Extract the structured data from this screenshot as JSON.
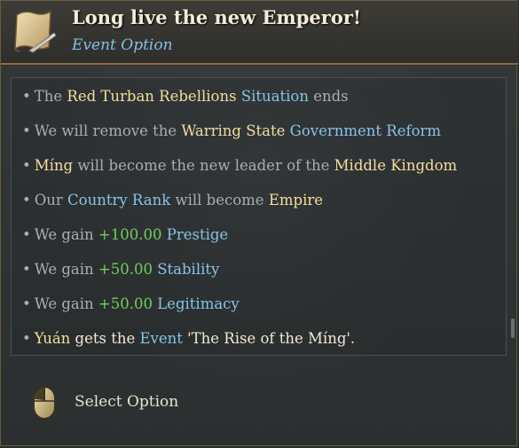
{
  "header": {
    "title": "Long live the new Emperor!",
    "subtitle": "Event Option",
    "icon": "scroll-quill-icon"
  },
  "effects": [
    [
      {
        "t": "The ",
        "c": "plain"
      },
      {
        "t": "Red Turban Rebellions",
        "c": "hl"
      },
      {
        "t": " ",
        "c": "plain"
      },
      {
        "t": "Situation",
        "c": "kw"
      },
      {
        "t": " ends",
        "c": "plain"
      }
    ],
    [
      {
        "t": "We will remove the ",
        "c": "plain"
      },
      {
        "t": "Warring State",
        "c": "hl"
      },
      {
        "t": " ",
        "c": "plain"
      },
      {
        "t": "Government Reform",
        "c": "kw"
      }
    ],
    [
      {
        "t": "Míng",
        "c": "hl"
      },
      {
        "t": " will become the new leader of the ",
        "c": "plain"
      },
      {
        "t": "Middle Kingdom",
        "c": "hl"
      }
    ],
    [
      {
        "t": "Our ",
        "c": "plain"
      },
      {
        "t": "Country Rank",
        "c": "kw"
      },
      {
        "t": " will become ",
        "c": "plain"
      },
      {
        "t": "Empire",
        "c": "hl"
      }
    ],
    [
      {
        "t": "We gain ",
        "c": "plain"
      },
      {
        "t": "+100.00",
        "c": "num"
      },
      {
        "t": " ",
        "c": "plain"
      },
      {
        "t": "Prestige",
        "c": "kw"
      }
    ],
    [
      {
        "t": "We gain ",
        "c": "plain"
      },
      {
        "t": "+50.00",
        "c": "num"
      },
      {
        "t": " ",
        "c": "plain"
      },
      {
        "t": "Stability",
        "c": "kw"
      }
    ],
    [
      {
        "t": "We gain ",
        "c": "plain"
      },
      {
        "t": "+50.00",
        "c": "num"
      },
      {
        "t": " ",
        "c": "plain"
      },
      {
        "t": "Legitimacy",
        "c": "kw"
      }
    ],
    [
      {
        "t": "Yuán",
        "c": "hl"
      },
      {
        "t": " gets the ",
        "c": "wt"
      },
      {
        "t": "Event",
        "c": "kw"
      },
      {
        "t": " '",
        "c": "wt"
      },
      {
        "t": "The Rise of the Míng",
        "c": "wt"
      },
      {
        "t": "'.",
        "c": "wt"
      }
    ]
  ],
  "bullet": "•",
  "select_option": {
    "label": "Select Option",
    "icon": "mouse-left-click-icon"
  },
  "colors": {
    "highlight": "#f1df9f",
    "keyword": "#86c4e6",
    "positive": "#6fcf5a",
    "plain": "#a9aeb1"
  }
}
